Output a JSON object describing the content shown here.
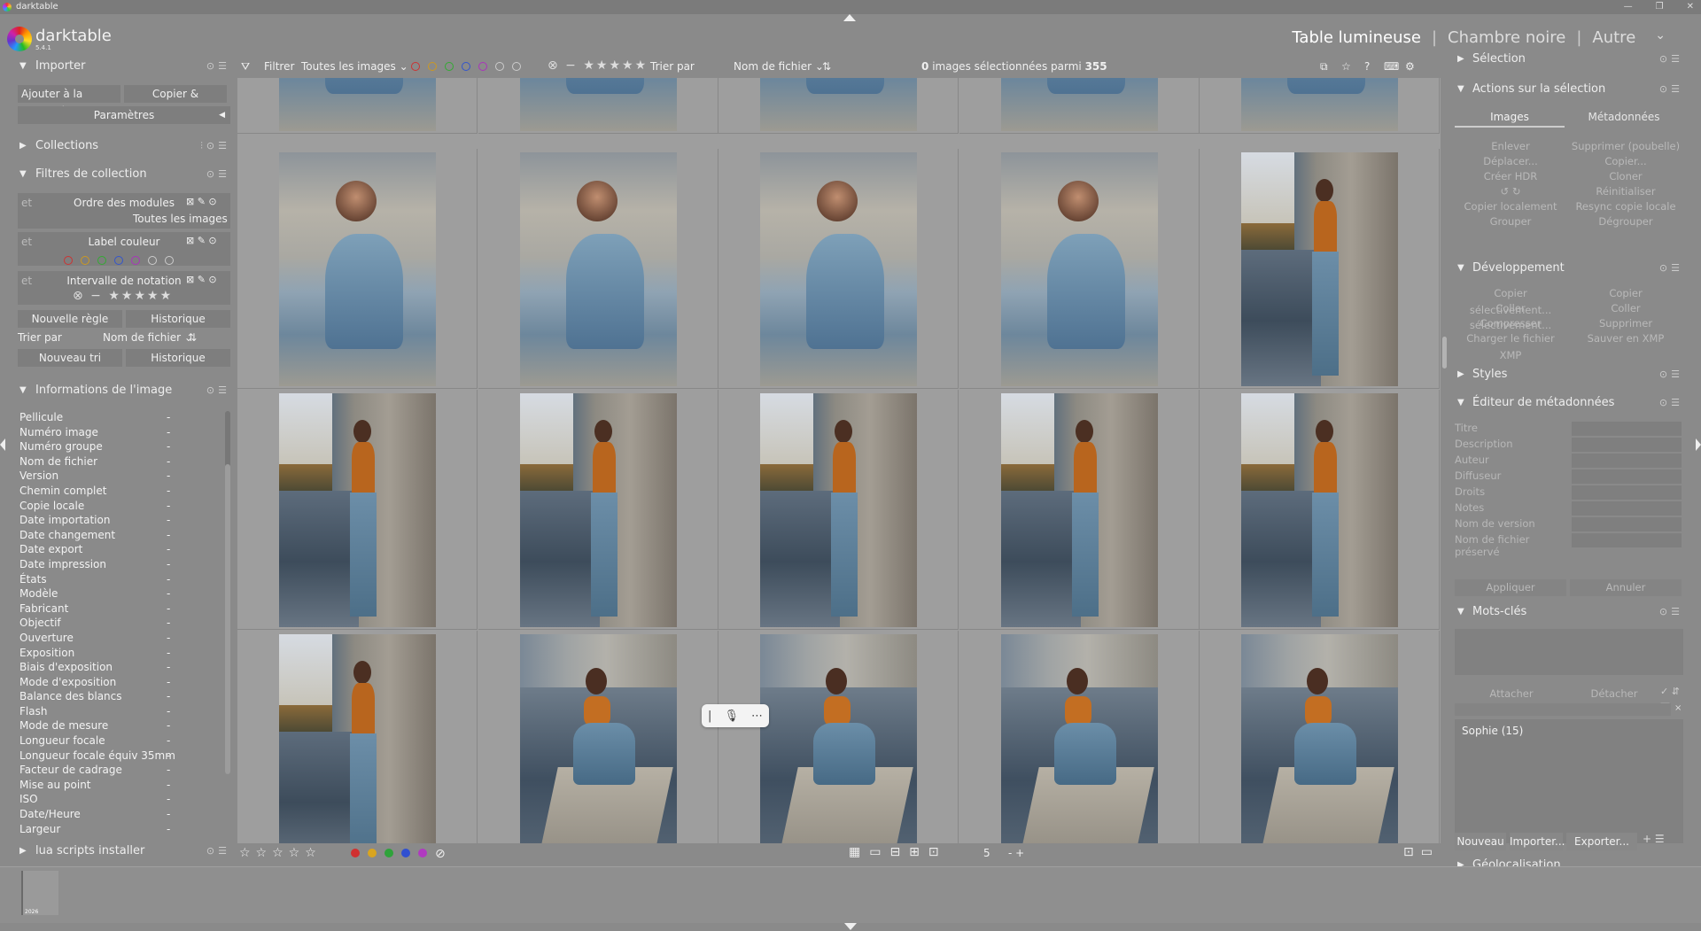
{
  "window": {
    "title": "darktable",
    "controls": [
      "—",
      "❐",
      "✕"
    ]
  },
  "app": {
    "name": "darktable",
    "version": "5.4.1"
  },
  "views": {
    "lighttable": "Table lumineuse",
    "darkroom": "Chambre noire",
    "other": "Autre",
    "separator": "|"
  },
  "left": {
    "import": {
      "title": "Importer",
      "add_btn": "Ajouter à la bibliothèque...",
      "copy_btn": "Copier & importer...",
      "params": "Paramètres"
    },
    "collections": {
      "title": "Collections"
    },
    "filters": {
      "title": "Filtres de collection",
      "rule1": {
        "prefix": "et",
        "label": "Ordre des modules",
        "value": "Toutes les images"
      },
      "rule2": {
        "prefix": "et",
        "label": "Label couleur"
      },
      "rule3": {
        "prefix": "et",
        "label": "Intervalle de notation"
      },
      "new_rule": "Nouvelle règle",
      "history": "Historique",
      "sort_label": "Trier par",
      "sort_value": "Nom de fichier",
      "new_sort": "Nouveau tri",
      "history2": "Historique"
    },
    "image_info": {
      "title": "Informations de l'image",
      "rows": [
        {
          "k": "Pellicule",
          "v": "-"
        },
        {
          "k": "Numéro image",
          "v": "-"
        },
        {
          "k": "Numéro groupe",
          "v": "-"
        },
        {
          "k": "Nom de fichier",
          "v": "-"
        },
        {
          "k": "Version",
          "v": "-"
        },
        {
          "k": "Chemin complet",
          "v": "-"
        },
        {
          "k": "Copie locale",
          "v": "-"
        },
        {
          "k": "Date importation",
          "v": "-"
        },
        {
          "k": "Date changement",
          "v": "-"
        },
        {
          "k": "Date export",
          "v": "-"
        },
        {
          "k": "Date impression",
          "v": "-"
        },
        {
          "k": "États",
          "v": "-"
        },
        {
          "k": "Modèle",
          "v": "-"
        },
        {
          "k": "Fabricant",
          "v": "-"
        },
        {
          "k": "Objectif",
          "v": "-"
        },
        {
          "k": "Ouverture",
          "v": "-"
        },
        {
          "k": "Exposition",
          "v": "-"
        },
        {
          "k": "Biais d'exposition",
          "v": "-"
        },
        {
          "k": "Mode d'exposition",
          "v": "-"
        },
        {
          "k": "Balance des blancs",
          "v": "-"
        },
        {
          "k": "Flash",
          "v": "-"
        },
        {
          "k": "Mode de mesure",
          "v": "-"
        },
        {
          "k": "Longueur focale",
          "v": "-"
        },
        {
          "k": "Longueur focale équiv 35mm",
          "v": "-"
        },
        {
          "k": "Facteur de cadrage",
          "v": "-"
        },
        {
          "k": "Mise au point",
          "v": "-"
        },
        {
          "k": "ISO",
          "v": "-"
        },
        {
          "k": "Date/Heure",
          "v": "-"
        },
        {
          "k": "Largeur",
          "v": "-"
        }
      ]
    },
    "lua": {
      "title": "lua scripts installer"
    }
  },
  "toolbar": {
    "filter_label": "Filtrer",
    "filter_value": "Toutes les images",
    "sort_label": "Trier par",
    "sort_value": "Nom de fichier",
    "selection_prefix": "0",
    "selection_text": "images sélectionnées parmi",
    "selection_total": "355"
  },
  "colors": {
    "red": "#d03030",
    "yellow": "#d9a520",
    "green": "#2fa33a",
    "blue": "#3050d0",
    "purple": "#b03ac0"
  },
  "grid": {
    "rows": [
      [
        "seat",
        "seat",
        "seat",
        "seat",
        "seat"
      ],
      [
        "seat",
        "seat",
        "seat",
        "seat",
        "wall"
      ],
      [
        "wall",
        "wall",
        "wall",
        "wall",
        "wall"
      ],
      [
        "wall",
        "sit",
        "sit",
        "sit",
        "sit"
      ]
    ]
  },
  "bottom": {
    "zoom": "5",
    "zoom_ctrl": "- +"
  },
  "right": {
    "selection": {
      "title": "Sélection"
    },
    "actions": {
      "title": "Actions sur la sélection",
      "tab_images": "Images",
      "tab_meta": "Métadonnées",
      "buttons": [
        [
          "Enlever",
          "Supprimer (poubelle)"
        ],
        [
          "Déplacer...",
          "Copier..."
        ],
        [
          "Créer HDR",
          "Cloner"
        ],
        [
          "↺   ↻",
          "Réinitialiser"
        ],
        [
          "Copier localement",
          "Resync copie locale"
        ],
        [
          "Grouper",
          "Dégrouper"
        ]
      ]
    },
    "dev": {
      "title": "Développement",
      "buttons": [
        [
          "Copier sélectivement...",
          "Copier"
        ],
        [
          "Coller sélectivement...",
          "Coller"
        ],
        [
          "Compresser",
          "Supprimer"
        ],
        [
          "Charger le fichier XMP",
          "Sauver en XMP"
        ]
      ]
    },
    "styles": {
      "title": "Styles"
    },
    "meta": {
      "title": "Éditeur de métadonnées",
      "fields": [
        "Titre",
        "Description",
        "Auteur",
        "Diffuseur",
        "Droits",
        "Notes",
        "Nom de version",
        "Nom de fichier préservé"
      ],
      "apply": "Appliquer",
      "cancel": "Annuler"
    },
    "keywords": {
      "title": "Mots-clés",
      "attach": "Attacher",
      "detach": "Détacher",
      "tag": "Sophie (15)",
      "new": "Nouveau",
      "import": "Importer...",
      "export": "Exporter..."
    },
    "geo": {
      "title": "Géolocalisation"
    }
  },
  "filmstrip": {
    "label": "2026"
  }
}
